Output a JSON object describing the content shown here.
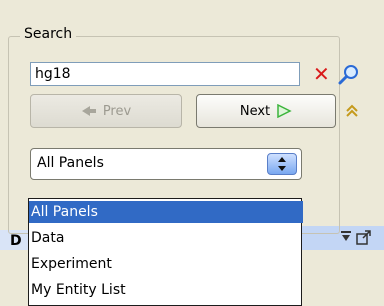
{
  "search": {
    "legend": "Search",
    "value": "hg18",
    "prev_label": "Prev",
    "next_label": "Next",
    "scope_value": "All Panels",
    "options": [
      "All Panels",
      "Data",
      "Experiment",
      "My Entity List"
    ],
    "selected_option": "All Panels"
  },
  "panel": {
    "title_letter": "D"
  },
  "icons": {
    "clear": "close-icon",
    "find": "magnifier-icon",
    "prev": "left-arrow-icon",
    "next": "right-arrow-icon",
    "collapse": "double-chevron-up-icon",
    "minimize": "minimize-icon",
    "popout": "popout-icon"
  },
  "colors": {
    "selection": "#316ac5",
    "clear": "#d91a1a",
    "next_arrow": "#3cb43c"
  }
}
